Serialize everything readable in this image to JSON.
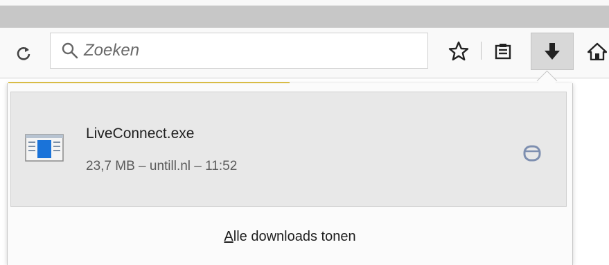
{
  "toolbar": {
    "search_placeholder": "Zoeken",
    "reload_icon": "reload-icon",
    "bookmark_icon": "star-icon",
    "reading_list_icon": "library-icon",
    "downloads_icon": "download-arrow-icon",
    "home_icon": "home-icon"
  },
  "downloads_panel": {
    "items": [
      {
        "file_name": "LiveConnect.exe",
        "size": "23,7 MB",
        "source": "untill.nl",
        "time": "11:52",
        "meta": "23,7 MB – untill.nl – 11:52",
        "icon": "executable-file-icon",
        "action_icon": "open-folder-icon"
      }
    ],
    "show_all_accesskey": "A",
    "show_all_rest": "lle downloads tonen"
  },
  "colors": {
    "tabstrip": "#c7c7c7",
    "item_background": "#e8e8e8",
    "accent_blue": "#1a73d9",
    "progress_yellow": "#e3c64a"
  }
}
